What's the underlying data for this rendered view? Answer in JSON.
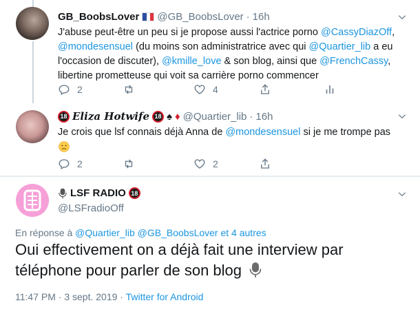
{
  "tweets": [
    {
      "name": "GB_BoobsLover",
      "handle": "@GB_BoobsLover",
      "dot": "·",
      "time": "16h",
      "body": {
        "p1": "J'abuse peut-être un peu si je propose aussi l'actrice porno ",
        "l1": "@CassyDiazOff",
        "p2": ", ",
        "l2": "@mondesensuel",
        "p3": " (du moins son administratrice avec qui ",
        "l3": "@Quartier_lib",
        "p4": " a eu l'occasion de discuter), ",
        "l4": "@kmille_love",
        "p5": " & son blog, ainsi que ",
        "l5": "@FrenchCassy",
        "p6": ", libertine prometteuse qui voit sa carrière porno commencer"
      },
      "replies": "2",
      "retweets": "",
      "likes": "4"
    },
    {
      "name": "𝑬𝒍𝒊𝒛𝒂 𝑯𝒐𝒕𝒘𝒊𝒇𝒆",
      "handle": "@Quartier_lib",
      "dot": "·",
      "time": "16h",
      "body": {
        "p1": "Je crois que lsf connais déjà Anna de ",
        "l1": "@mondesensuel",
        "p2": "  si je me trompe pas"
      },
      "replies": "2",
      "retweets": "",
      "likes": "2"
    }
  ],
  "main": {
    "name": "LSF RADIO",
    "handle": "@LSFradioOff",
    "reply_prefix": "En réponse à ",
    "reply_to1": "@Quartier_lib",
    "reply_to2": "@GB_BoobsLover",
    "reply_others": "et 4 autres",
    "text": "Oui effectivement on a déjà fait une interview par téléphone pour parler de son blog",
    "time": "11:47 PM · 3 sept. 2019",
    "sep": "·",
    "source": "Twitter for Android"
  },
  "badge18": "18",
  "colors": {
    "link": "#1b95e0",
    "muted": "#657786",
    "text": "#14171a",
    "badge_ring": "#d41f2a",
    "avatar_pink": "#f6a0d8"
  }
}
